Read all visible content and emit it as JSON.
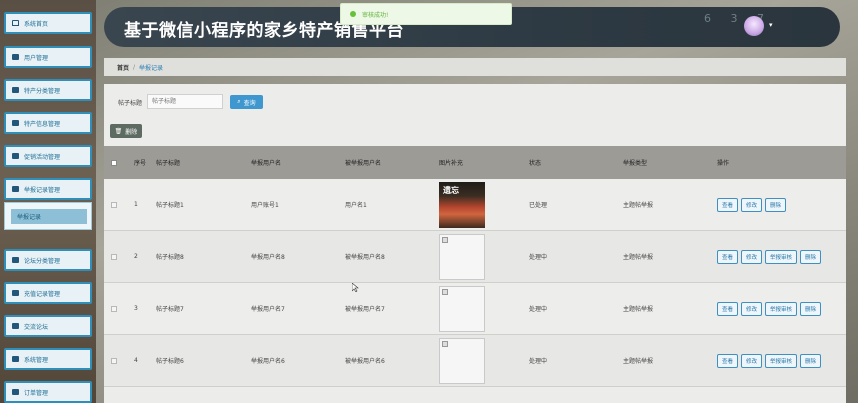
{
  "app": {
    "title": "基于微信小程序的家乡特产销售平台",
    "header_deco": "6 3 7",
    "avatar_caret": "▾"
  },
  "toast": {
    "text": "审核成功!"
  },
  "sidebar": {
    "items": [
      {
        "label": "系统首页",
        "icon": "home-icon"
      },
      {
        "label": "用户管理",
        "icon": "user-icon"
      },
      {
        "label": "特产分类管理",
        "icon": "grid-icon"
      },
      {
        "label": "特产信息管理",
        "icon": "box-icon"
      },
      {
        "label": "促销活动管理",
        "icon": "list-icon"
      },
      {
        "label": "举报记录管理",
        "icon": "report-icon"
      },
      {
        "label": "论坛分类管理",
        "icon": "grid-icon"
      },
      {
        "label": "充值记录管理",
        "icon": "list-icon"
      },
      {
        "label": "交流论坛",
        "icon": "forum-icon"
      },
      {
        "label": "系统管理",
        "icon": "grid-icon"
      },
      {
        "label": "订单管理",
        "icon": "order-icon"
      }
    ],
    "submenu": {
      "label": "举报记录"
    }
  },
  "breadcrumb": {
    "home": "首页",
    "sep": "/",
    "current": "举报记录"
  },
  "search": {
    "label": "帖子标题",
    "placeholder": "帖子标题",
    "query_label": "查询"
  },
  "toolbar": {
    "delete_label": "删除"
  },
  "table": {
    "columns": [
      "序号",
      "帖子标题",
      "举报用户名",
      "被举报用户名",
      "图片补充",
      "状态",
      "举报类型",
      "操作"
    ],
    "rows": [
      {
        "index": "1",
        "title": "帖子标题1",
        "reporter": "用户账号1",
        "reported": "用户名1",
        "image": "photo",
        "image_text": "遗忘",
        "status": "已处理",
        "type": "主题帖举报",
        "actions": [
          "查看",
          "修改",
          "删除"
        ]
      },
      {
        "index": "2",
        "title": "帖子标题8",
        "reporter": "举报用户名8",
        "reported": "被举报用户名8",
        "image": "broken",
        "status": "处理中",
        "type": "主题帖举报",
        "actions": [
          "查看",
          "修改",
          "举报审核",
          "删除"
        ]
      },
      {
        "index": "3",
        "title": "帖子标题7",
        "reporter": "举报用户名7",
        "reported": "被举报用户名7",
        "image": "broken",
        "status": "处理中",
        "type": "主题帖举报",
        "actions": [
          "查看",
          "修改",
          "举报审核",
          "删除"
        ]
      },
      {
        "index": "4",
        "title": "帖子标题6",
        "reporter": "举报用户名6",
        "reported": "被举报用户名6",
        "image": "broken",
        "status": "处理中",
        "type": "主题帖举报",
        "actions": [
          "查看",
          "修改",
          "举报审核",
          "删除"
        ]
      }
    ]
  },
  "colors": {
    "accent": "#2f8fb8",
    "header": "#2e3a43",
    "success": "#67c23a"
  }
}
